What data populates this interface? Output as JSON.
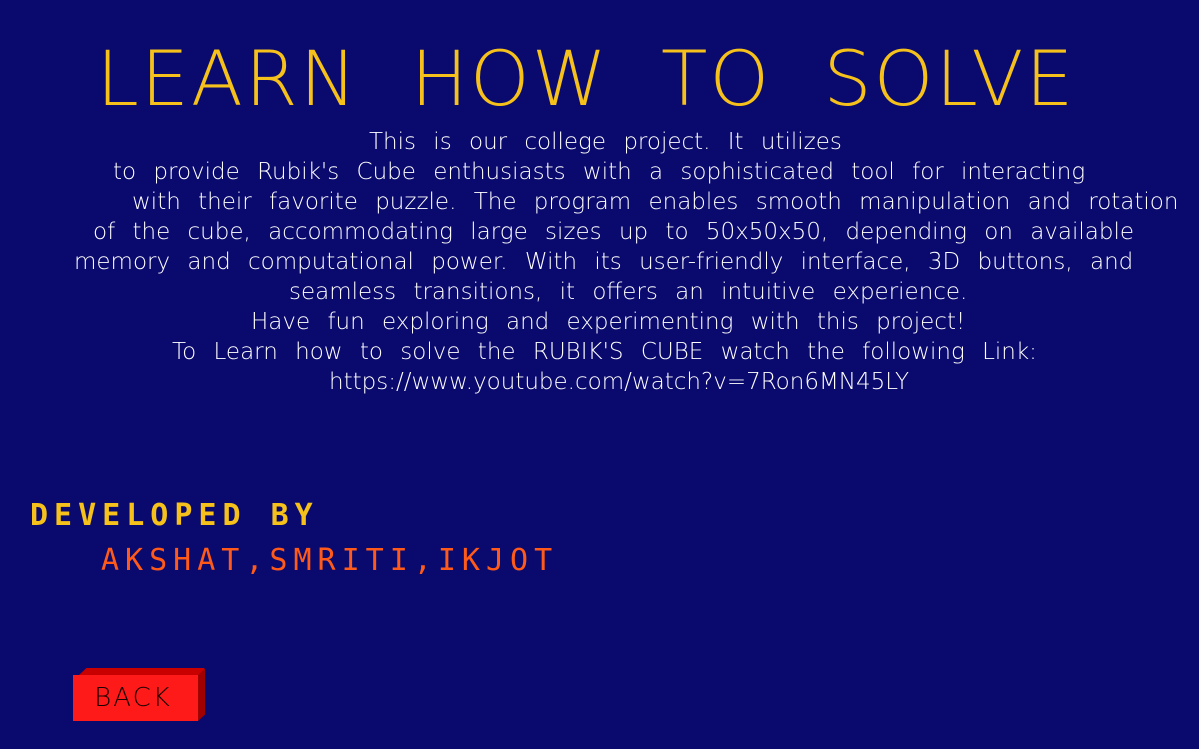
{
  "header": {
    "title": "LEARN HOW TO SOLVE"
  },
  "description": {
    "lines": [
      "This is our college project. It utilizes",
      "to provide Rubik's Cube enthusiasts with a sophisticated tool for interacting",
      "with their favorite puzzle. The program enables smooth manipulation and rotation",
      "of the cube, accommodating large sizes up to 50x50x50, depending on available",
      "memory and computational power. With its user-friendly interface, 3D buttons, and",
      "seamless transitions, it offers an intuitive experience.",
      "Have fun exploring and experimenting with this project!",
      "To Learn how to solve the RUBIK'S CUBE watch the following Link:",
      "https://www.youtube.com/watch?v=7Ron6MN45LY"
    ]
  },
  "credits": {
    "heading": "DEVELOPED BY",
    "names": "AKSHAT,SMRITI,IKJOT"
  },
  "back_button": {
    "label": "BACK"
  },
  "colors": {
    "background": "#0a0a6e",
    "title": "#f5c11a",
    "body_text": "#ffffff",
    "heading": "#f5c11a",
    "names": "#ff5a1a",
    "button": "#ff1a1a"
  }
}
